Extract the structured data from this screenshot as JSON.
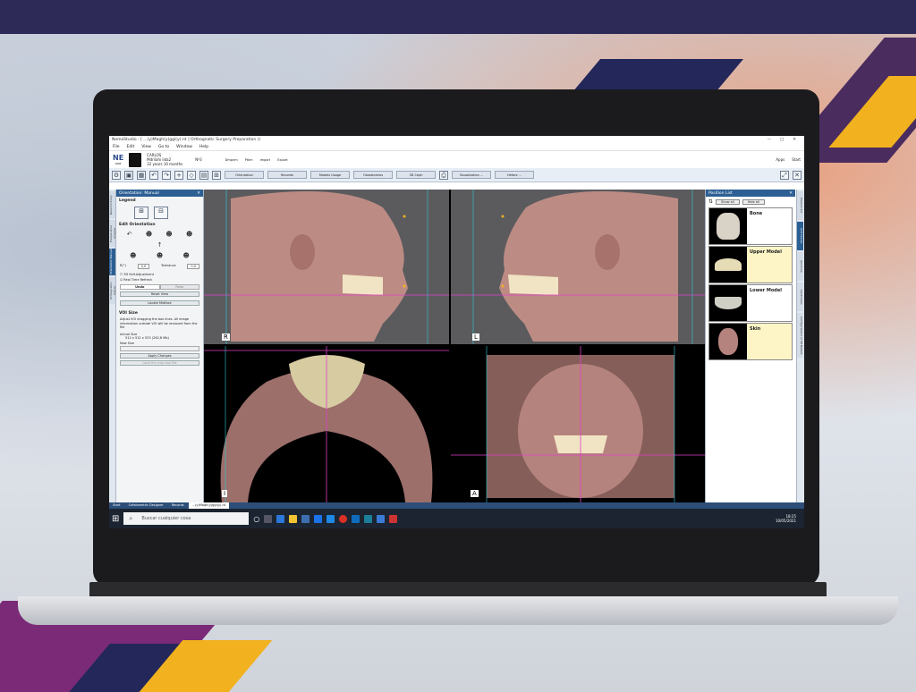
{
  "window": {
    "title": "NemoStudio - [ ...(y)Magh(y)ggi(y).nt ] Orthognatic Surgery Preparation ()",
    "controls": [
      "—",
      "□",
      "✕"
    ]
  },
  "menu": [
    "File",
    "Edit",
    "View",
    "Go to",
    "Window",
    "Help"
  ],
  "patient": {
    "badge": "NE",
    "badge_sub": "ROB",
    "name": "CARLOS",
    "surname": "Mdrilahi lida2",
    "age": "32 years 10 months",
    "nf": "Nº3",
    "labels": [
      "Dmpnm",
      "Ptkm",
      "Import",
      "Export"
    ],
    "right": [
      "Apps",
      "Start"
    ]
  },
  "toolbar": {
    "buttons": [
      "Orientation",
      "Records",
      "Models Usage",
      "Osteotomies",
      "3D Ceph",
      "Visualization ...",
      "Hefore ..."
    ]
  },
  "left_panel": {
    "title": "Orientation: Manual",
    "legend": "Legend",
    "edit_orientation": "Edit Orientation",
    "fields": [
      {
        "label": "R(°)",
        "value": "0,0"
      },
      {
        "label": "Tolerance",
        "value": "0,0"
      }
    ],
    "checks": [
      {
        "label": "3D Self-Adjustment",
        "checked": false
      },
      {
        "label": "Real Time Refresh",
        "checked": true
      }
    ],
    "tabs": [
      "Undo",
      "Redo"
    ],
    "buttons": [
      "Reset View",
      "Locate Midface"
    ],
    "voi_title": "VOI Size",
    "voi_desc": "Adjust VOI dragging the box lines. All image information outside VOI will be removed from the file",
    "actual_size_label": "Actual Size",
    "actual_size": "512 x 512 x 533 (262,8 Mb)",
    "new_size_label": "New Size",
    "apply": "Apply Changes",
    "disabled": "Load the crop tool file"
  },
  "viewports": {
    "labels": [
      "R",
      "L",
      "I",
      "A"
    ]
  },
  "positions": {
    "title": "Position List",
    "show_all": "Show all",
    "hide_all": "Hide all",
    "models": [
      {
        "name": "Bone",
        "highlight": false
      },
      {
        "name": "Upper Model",
        "highlight": true
      },
      {
        "name": "Lower Model",
        "highlight": false
      },
      {
        "name": "Skin",
        "highlight": true
      }
    ]
  },
  "right_tabs": [
    "Position list",
    "Soft tissues",
    "Quick Go",
    "Landmarks",
    "Configurations of 3D Models"
  ],
  "left_tabs": [
    "Record Library",
    "Preoperative Surgical",
    "Orientation Manual",
    "Orthognathic Trainer"
  ],
  "statusbar": [
    "Start",
    "Cefalometric Designer",
    "Records",
    "...(y)Magh(y)ggi(y).nt"
  ],
  "taskbar": {
    "search_placeholder": "Buscar cualquier cosa",
    "time": "18:25",
    "date": "10/05/2021"
  },
  "colors": {
    "accent": "#2c5f93",
    "bg_top": "#2e2a58",
    "stripe_purple": "#7b2a78",
    "stripe_yellow": "#f2b21f",
    "stripe_navy": "#23275a",
    "magenta_line": "#e040c8",
    "cyan_line": "#30c8d8"
  }
}
